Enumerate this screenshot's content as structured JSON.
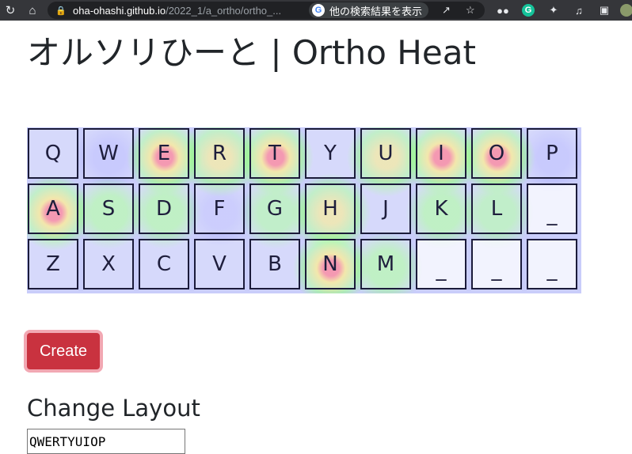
{
  "browser": {
    "url_host": "oha-ohashi.github.io",
    "url_path": "/2022_1/a_ortho/ortho_...",
    "google_pill_label": "他の検索結果を表示",
    "google_logo": "G",
    "icons": {
      "reload": "reload-icon",
      "home": "home-icon",
      "lock": "lock-icon",
      "share": "share-icon",
      "bookmark": "star-icon",
      "extension1": "glasses-icon",
      "extension2": "grammarly-icon",
      "extensions": "puzzle-icon",
      "media": "media-icon",
      "sidepanel": "sidepanel-icon"
    }
  },
  "page": {
    "title": "オルソリひーと | Ortho Heat"
  },
  "keyboard": {
    "rows": [
      [
        "Q",
        "W",
        "E",
        "R",
        "T",
        "Y",
        "U",
        "I",
        "O",
        "P"
      ],
      [
        "A",
        "S",
        "D",
        "F",
        "G",
        "H",
        "J",
        "K",
        "L",
        "_"
      ],
      [
        "Z",
        "X",
        "C",
        "V",
        "B",
        "N",
        "M",
        "_",
        "_",
        "_"
      ]
    ],
    "heat_colors": {
      "hot": "#ff5a78",
      "warm": "#ffe664",
      "mid": "#96ff82",
      "cold": "#c9cdfa"
    }
  },
  "actions": {
    "create_label": "Create",
    "create_color": "#c9323f"
  },
  "layout_form": {
    "heading": "Change Layout",
    "value": "QWERTYUIOP"
  }
}
